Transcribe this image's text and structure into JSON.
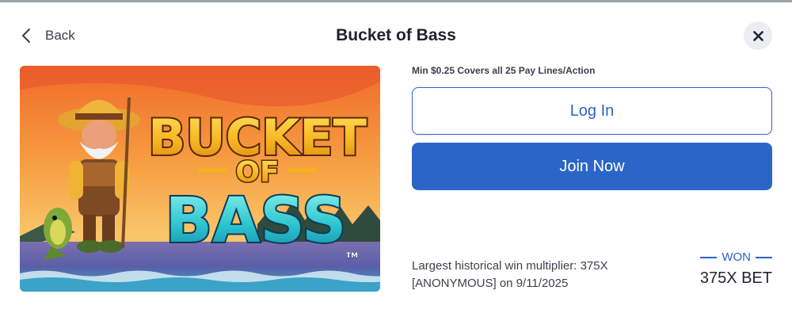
{
  "header": {
    "back_label": "Back",
    "title": "Bucket of Bass",
    "back_icon": "chevron-left-icon",
    "close_icon": "close-icon"
  },
  "game_art": {
    "logo_line1": "BUCKET",
    "logo_line2": "OF",
    "logo_line3": "BASS",
    "trademark": "TM"
  },
  "offer": {
    "min_bet_text": "Min $0.25 Covers all 25 Pay Lines/Action",
    "login_label": "Log In",
    "join_label": "Join Now"
  },
  "win": {
    "multiplier_text": "Largest historical win multiplier: 375X",
    "winner_text": "[ANONYMOUS] on 9/11/2025",
    "badge_label": "WON",
    "badge_value": "375X BET"
  },
  "colors": {
    "accent": "#2b65c7",
    "title": "#1d2230",
    "close_bg": "#ecedf0"
  }
}
